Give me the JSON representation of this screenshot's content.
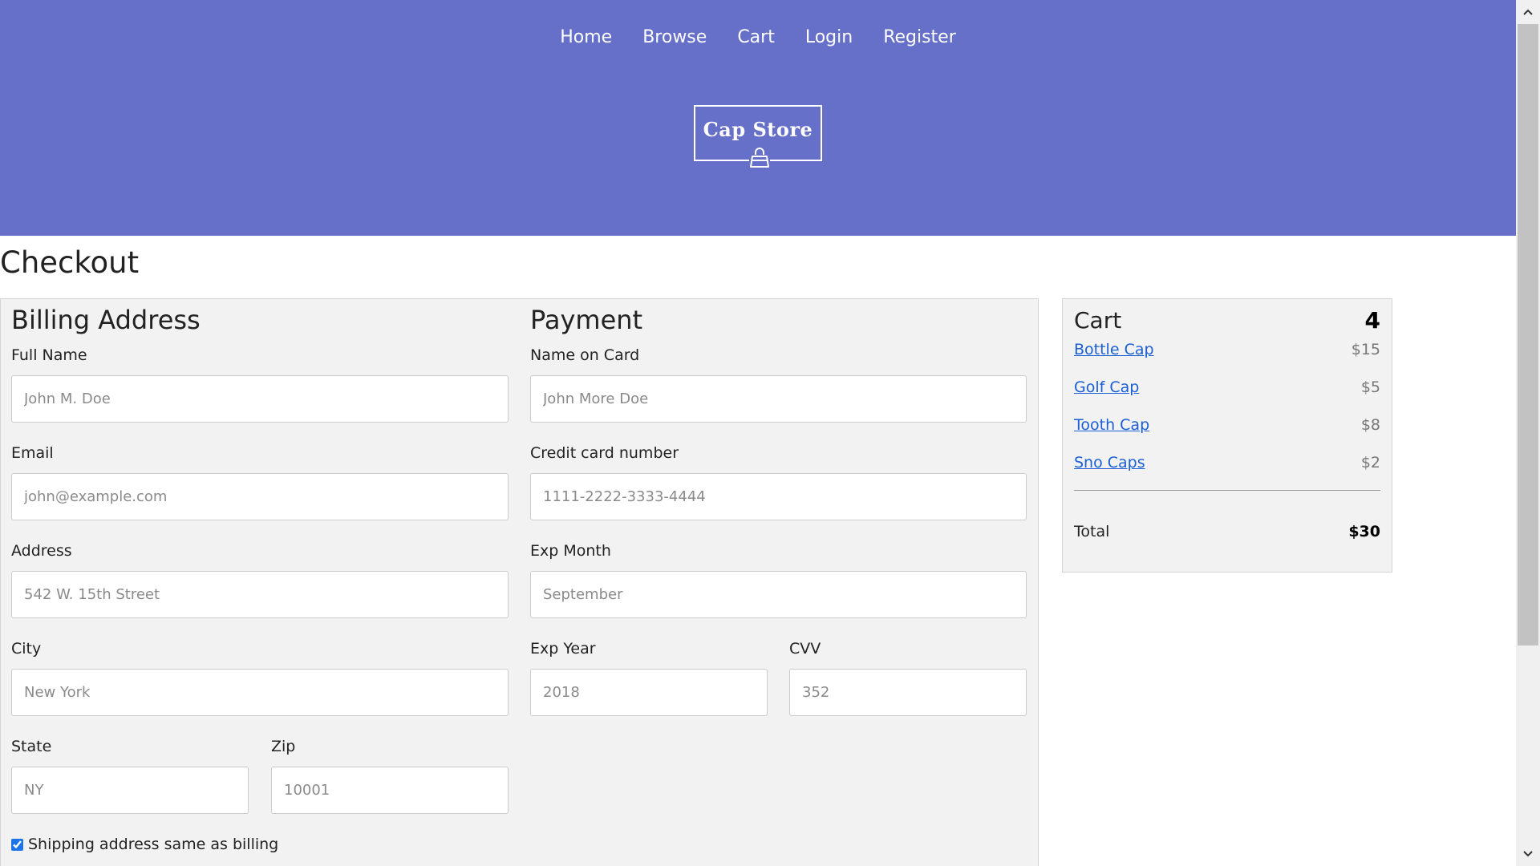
{
  "nav": {
    "items": [
      "Home",
      "Browse",
      "Cart",
      "Login",
      "Register"
    ]
  },
  "logo": {
    "text": "Cap Store",
    "icon": "shopping-bag-icon"
  },
  "page": {
    "title": "Checkout"
  },
  "billing": {
    "title": "Billing Address",
    "full_name": {
      "label": "Full Name",
      "placeholder": "John M. Doe"
    },
    "email": {
      "label": "Email",
      "placeholder": "john@example.com"
    },
    "address": {
      "label": "Address",
      "placeholder": "542 W. 15th Street"
    },
    "city": {
      "label": "City",
      "placeholder": "New York"
    },
    "state": {
      "label": "State",
      "placeholder": "NY"
    },
    "zip": {
      "label": "Zip",
      "placeholder": "10001"
    }
  },
  "payment": {
    "title": "Payment",
    "name_on_card": {
      "label": "Name on Card",
      "placeholder": "John More Doe"
    },
    "card_number": {
      "label": "Credit card number",
      "placeholder": "1111-2222-3333-4444"
    },
    "exp_month": {
      "label": "Exp Month",
      "placeholder": "September"
    },
    "exp_year": {
      "label": "Exp Year",
      "placeholder": "2018"
    },
    "cvv": {
      "label": "CVV",
      "placeholder": "352"
    }
  },
  "shipping_same": {
    "label": "Shipping address same as billing",
    "checked": true
  },
  "cart": {
    "title": "Cart",
    "count": "4",
    "items": [
      {
        "name": "Bottle Cap",
        "price": "$15"
      },
      {
        "name": "Golf Cap",
        "price": "$5"
      },
      {
        "name": "Tooth Cap",
        "price": "$8"
      },
      {
        "name": "Sno Caps",
        "price": "$2"
      }
    ],
    "total_label": "Total",
    "total_value": "$30"
  },
  "colors": {
    "header_bg": "#6670c9",
    "panel_bg": "#f2f2f2",
    "link": "#1a5fd6",
    "checkbox": "#1a73e8"
  }
}
